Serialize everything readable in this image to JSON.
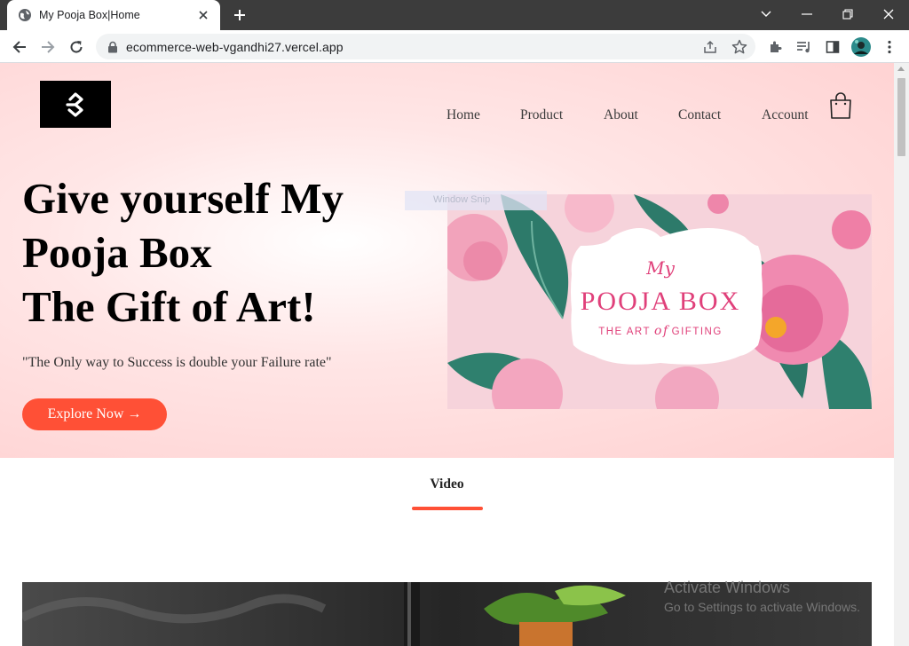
{
  "browser": {
    "tab_title": "My Pooja Box|Home",
    "url": "ecommerce-web-vgandhi27.vercel.app"
  },
  "nav": {
    "items": [
      {
        "label": "Home"
      },
      {
        "label": "Product"
      },
      {
        "label": "About"
      },
      {
        "label": "Contact"
      },
      {
        "label": "Account"
      }
    ]
  },
  "hero": {
    "title_lines": [
      "Give yourself My",
      "Pooja Box",
      "The Gift of Art!"
    ],
    "quote": "\"The Only way to Success is double your Failure rate\"",
    "cta_label": "Explore Now →"
  },
  "overlay": {
    "window_snip": "Window Snip"
  },
  "banner": {
    "my": "My",
    "brand": "POOJA BOX",
    "tagline_pre": "THE ART",
    "tagline_of": "of",
    "tagline_post": "GIFTING"
  },
  "section": {
    "title": "Video"
  },
  "watermark": {
    "title": "Activate Windows",
    "subtitle": "Go to Settings to activate Windows."
  },
  "colors": {
    "accent": "#ff5036",
    "hero_bg": "#ffd0d0",
    "brand_pink": "#e0407a"
  }
}
